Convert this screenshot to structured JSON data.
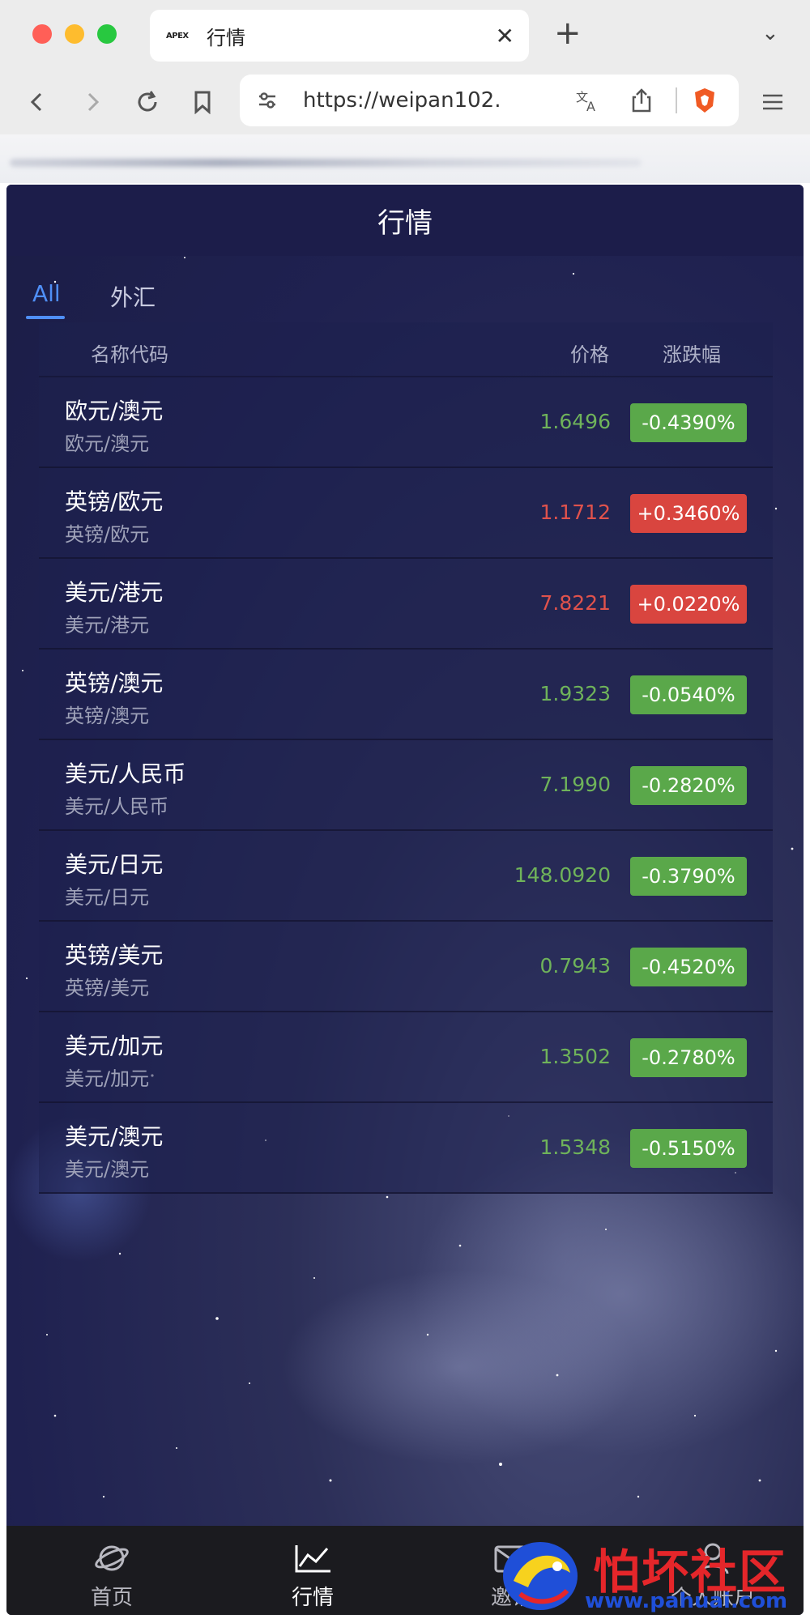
{
  "browser": {
    "tab_favicon_text": "APEX",
    "tab_title": "行情",
    "url": "https://weipan102.",
    "new_tab": "+"
  },
  "app": {
    "title": "行情",
    "tabs": [
      {
        "label": "All",
        "active": true
      },
      {
        "label": "外汇",
        "active": false
      }
    ],
    "table": {
      "headers": {
        "name": "名称代码",
        "price": "价格",
        "change": "涨跌幅"
      },
      "rows": [
        {
          "name": "欧元/澳元",
          "code": "欧元/澳元",
          "price": "1.6496",
          "change": "-0.4390%",
          "dir": "down"
        },
        {
          "name": "英镑/欧元",
          "code": "英镑/欧元",
          "price": "1.1712",
          "change": "+0.3460%",
          "dir": "up"
        },
        {
          "name": "美元/港元",
          "code": "美元/港元",
          "price": "7.8221",
          "change": "+0.0220%",
          "dir": "up"
        },
        {
          "name": "英镑/澳元",
          "code": "英镑/澳元",
          "price": "1.9323",
          "change": "-0.0540%",
          "dir": "down"
        },
        {
          "name": "美元/人民币",
          "code": "美元/人民币",
          "price": "7.1990",
          "change": "-0.2820%",
          "dir": "down"
        },
        {
          "name": "美元/日元",
          "code": "美元/日元",
          "price": "148.0920",
          "change": "-0.3790%",
          "dir": "down"
        },
        {
          "name": "英镑/美元",
          "code": "英镑/美元",
          "price": "0.7943",
          "change": "-0.4520%",
          "dir": "down"
        },
        {
          "name": "美元/加元",
          "code": "美元/加元",
          "price": "1.3502",
          "change": "-0.2780%",
          "dir": "down"
        },
        {
          "name": "美元/澳元",
          "code": "美元/澳元",
          "price": "1.5348",
          "change": "-0.5150%",
          "dir": "down"
        }
      ]
    },
    "colors": {
      "up": "#d9453f",
      "down": "#5aa84a",
      "up_text": "#e0524c",
      "down_text": "#6fb35a",
      "accent": "#4f8ff7"
    },
    "bottom_nav": [
      {
        "label": "首页",
        "icon": "planet-icon",
        "active": false
      },
      {
        "label": "行情",
        "icon": "chart-line-icon",
        "active": true
      },
      {
        "label": "邀请",
        "icon": "invite-icon",
        "active": false
      },
      {
        "label": "个人账户",
        "icon": "user-icon",
        "active": false
      }
    ]
  },
  "watermark": {
    "text": "怕坏社区",
    "url": "www.pahuai.com"
  }
}
